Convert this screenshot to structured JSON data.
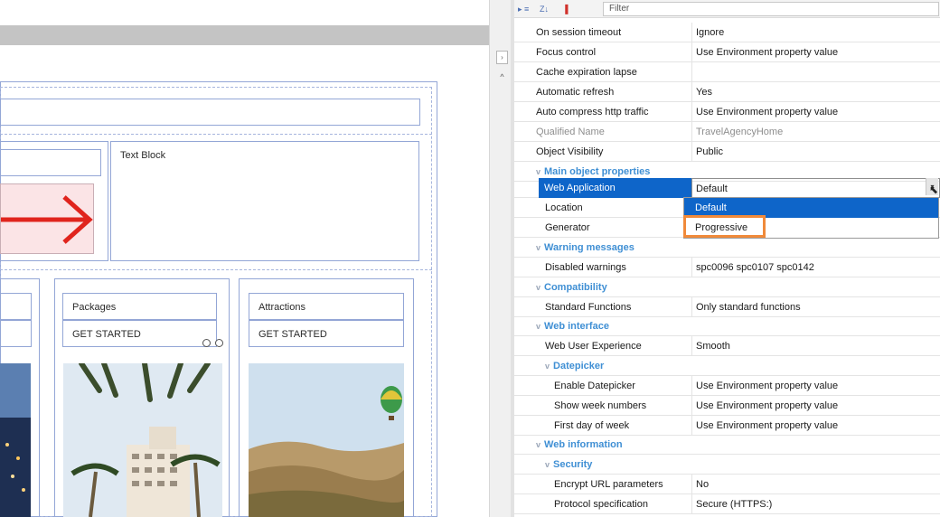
{
  "toolbar": {
    "sort_icon_label": "▸ ≡",
    "az_label": "Z↓",
    "flag_label": "▐",
    "filter_placeholder": "Filter"
  },
  "designer": {
    "text_block": "Text Block",
    "packages": "Packages",
    "attractions": "Attractions",
    "get_started_1": "GET STARTED",
    "get_started_2": "GET STARTED"
  },
  "properties": {
    "rows": [
      {
        "key": "On session timeout",
        "value": "Ignore"
      },
      {
        "key": "Focus control",
        "value": "Use Environment property value"
      },
      {
        "key": "Cache expiration lapse",
        "value": ""
      },
      {
        "key": "Automatic refresh",
        "value": "Yes"
      },
      {
        "key": "Auto compress http traffic",
        "value": "Use Environment property value"
      },
      {
        "key": "Qualified Name",
        "value": "TravelAgencyHome"
      },
      {
        "key": "Object Visibility",
        "value": "Public"
      }
    ],
    "cat_main": "Main object properties",
    "web_application": {
      "key": "Web Application",
      "value": "Default"
    },
    "location": {
      "key": "Location"
    },
    "generator": {
      "key": "Generator"
    },
    "dropdown_options": [
      "Default",
      "Progressive"
    ],
    "cat_warning": "Warning messages",
    "disabled_warnings": {
      "key": "Disabled warnings",
      "value": "spc0096 spc0107 spc0142"
    },
    "cat_compat": "Compatibility",
    "standard_functions": {
      "key": "Standard Functions",
      "value": "Only standard functions"
    },
    "cat_web_interface": "Web interface",
    "web_user_experience": {
      "key": "Web User Experience",
      "value": "Smooth"
    },
    "cat_datepicker": "Datepicker",
    "enable_datepicker": {
      "key": "Enable Datepicker",
      "value": "Use Environment property value"
    },
    "show_week_numbers": {
      "key": "Show week numbers",
      "value": "Use Environment property value"
    },
    "first_day_of_week": {
      "key": "First day of week",
      "value": "Use Environment property value"
    },
    "cat_web_information": "Web information",
    "cat_security": "Security",
    "encrypt_url": {
      "key": "Encrypt URL parameters",
      "value": "No"
    },
    "protocol_spec": {
      "key": "Protocol specification",
      "value": "Secure (HTTPS:)"
    }
  },
  "colors": {
    "accent": "#0e65c9",
    "category": "#3f8fd4",
    "highlight": "#f08a3a",
    "arrow": "#e0241d"
  }
}
